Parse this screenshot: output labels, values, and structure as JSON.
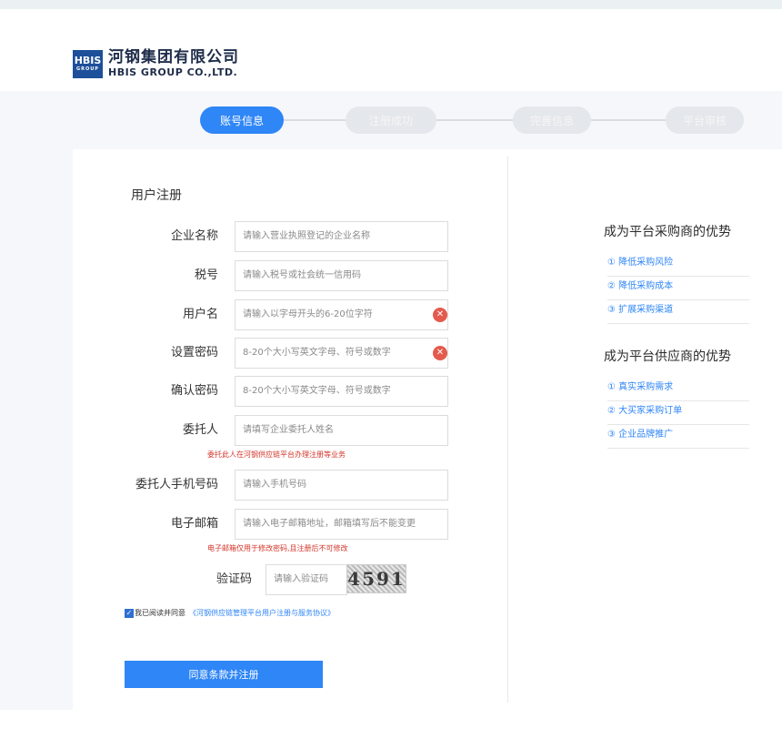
{
  "logo": {
    "badge_top": "HBIS",
    "badge_bottom": "GROUP",
    "name_cn": "河钢集团有限公司",
    "name_en": "HBIS GROUP CO.,LTD."
  },
  "steps": [
    "账号信息",
    "注册成功",
    "完善信息",
    "平台审核"
  ],
  "form": {
    "title": "用户注册",
    "fields": [
      {
        "label": "企业名称",
        "placeholder": "请输入营业执照登记的企业名称"
      },
      {
        "label": "税号",
        "placeholder": "请输入税号或社会统一信用码"
      },
      {
        "label": "用户名",
        "placeholder": "请输入以字母开头的6-20位字符"
      },
      {
        "label": "设置密码",
        "placeholder": "8-20个大小写英文字母、符号或数字"
      },
      {
        "label": "确认密码",
        "placeholder": "8-20个大小写英文字母、符号或数字"
      },
      {
        "label": "委托人",
        "placeholder": "请填写企业委托人姓名"
      },
      {
        "label": "委托人手机号码",
        "placeholder": "请输入手机号码"
      },
      {
        "label": "电子邮箱",
        "placeholder": "请输入电子邮箱地址，邮箱填写后不能变更"
      }
    ],
    "hint_delegate": "委托此人在河钢供应链平台办理注册等业务",
    "hint_email": "电子邮箱仅用于修改密码,且注册后不可修改",
    "captcha_label": "验证码",
    "captcha_placeholder": "请输入验证码",
    "captcha_text": "4591",
    "agree_text": "我已阅读并同意",
    "agree_link": "《河钢供应链管理平台用户注册与服务协议》",
    "submit": "同意条款并注册"
  },
  "advantages": {
    "buyer_title": "成为平台采购商的优势",
    "buyer_items": [
      "① 降低采购风险",
      "② 降低采购成本",
      "③ 扩展采购渠道"
    ],
    "supplier_title": "成为平台供应商的优势",
    "supplier_items": [
      "① 真实采购需求",
      "② 大买家采购订单",
      "③ 企业品牌推广"
    ]
  },
  "colors": {
    "accent": "#2f86f6",
    "error": "#e45a4d",
    "hint": "#d3362b"
  }
}
